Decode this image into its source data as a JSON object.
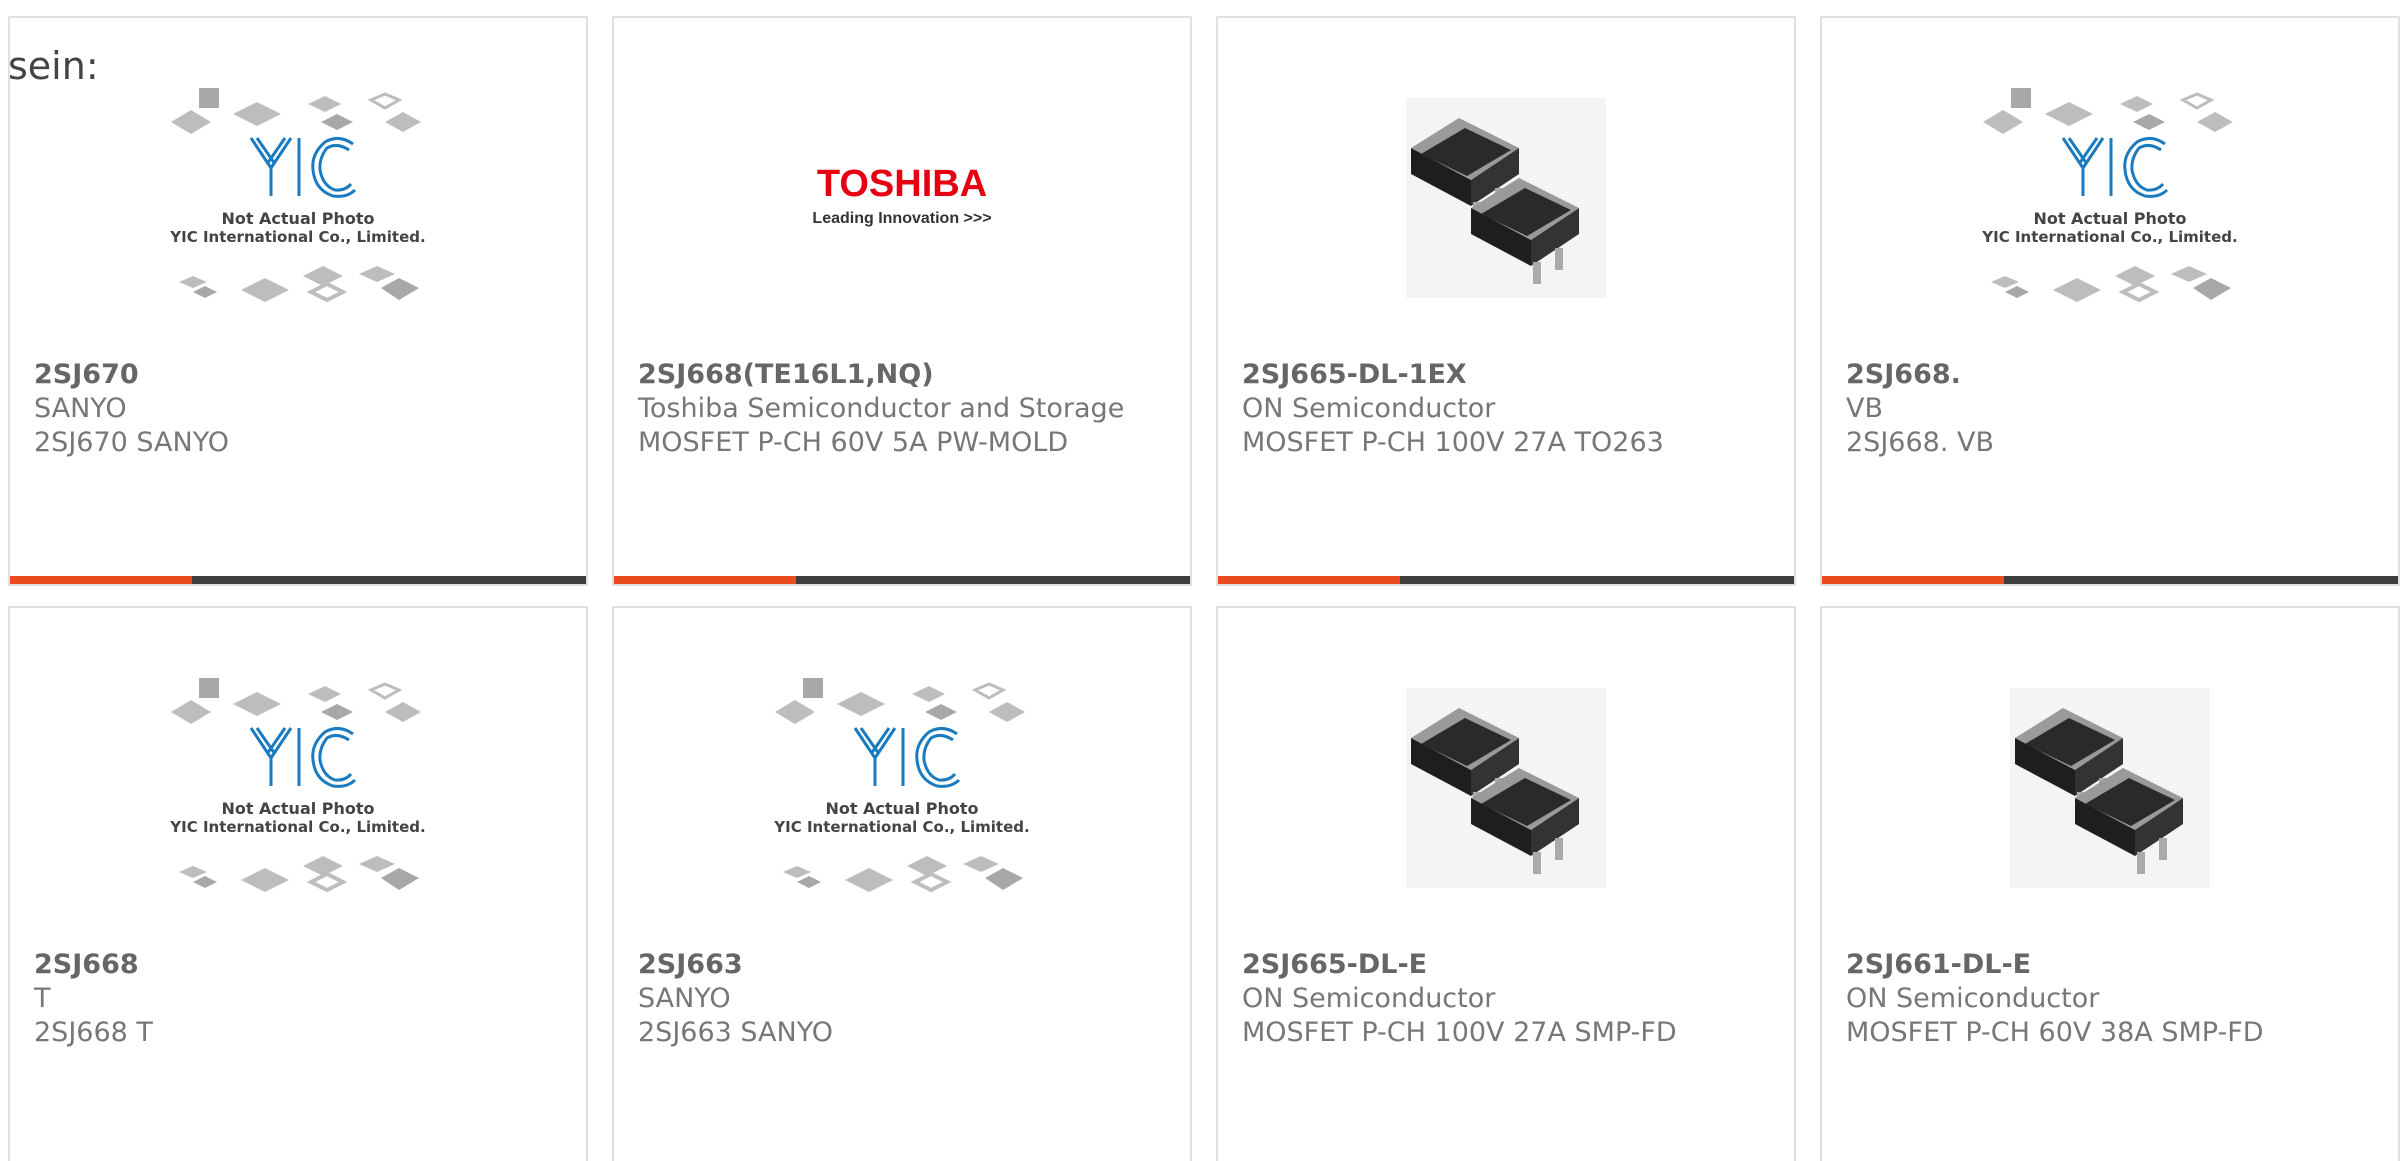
{
  "lead_text": "sein:",
  "colors": {
    "accent": "#ea4b1e",
    "bar": "#3d3d3d",
    "card_border": "#e0e0e0",
    "text": "#666666",
    "toshiba_red": "#e60012",
    "yic_blue": "#1a7bbf"
  },
  "placeholder": {
    "title": "Not Actual Photo",
    "subtitle": "YIC International Co., Limited."
  },
  "toshiba_logo": {
    "name": "TOSHIBA",
    "tagline": "Leading Innovation >>>"
  },
  "products": [
    {
      "part": "2SJ670",
      "manufacturer": "SANYO",
      "description": "2SJ670 SANYO",
      "image": "yic-placeholder"
    },
    {
      "part": "2SJ668(TE16L1,NQ)",
      "manufacturer": "Toshiba Semiconductor and Storage",
      "description": "MOSFET P-CH 60V 5A PW-MOLD",
      "image": "toshiba-logo"
    },
    {
      "part": "2SJ665-DL-1EX",
      "manufacturer": "ON Semiconductor",
      "description": "MOSFET P-CH 100V 27A TO263",
      "image": "to263-package"
    },
    {
      "part": "2SJ668.",
      "manufacturer": "VB",
      "description": "2SJ668. VB",
      "image": "yic-placeholder"
    },
    {
      "part": "2SJ668",
      "manufacturer": "T",
      "description": "2SJ668 T",
      "image": "yic-placeholder"
    },
    {
      "part": "2SJ663",
      "manufacturer": "SANYO",
      "description": "2SJ663 SANYO",
      "image": "yic-placeholder"
    },
    {
      "part": "2SJ665-DL-E",
      "manufacturer": "ON Semiconductor",
      "description": "MOSFET P-CH 100V 27A SMP-FD",
      "image": "to263-package"
    },
    {
      "part": "2SJ661-DL-E",
      "manufacturer": "ON Semiconductor",
      "description": "MOSFET P-CH 60V 38A SMP-FD",
      "image": "to263-package"
    }
  ]
}
